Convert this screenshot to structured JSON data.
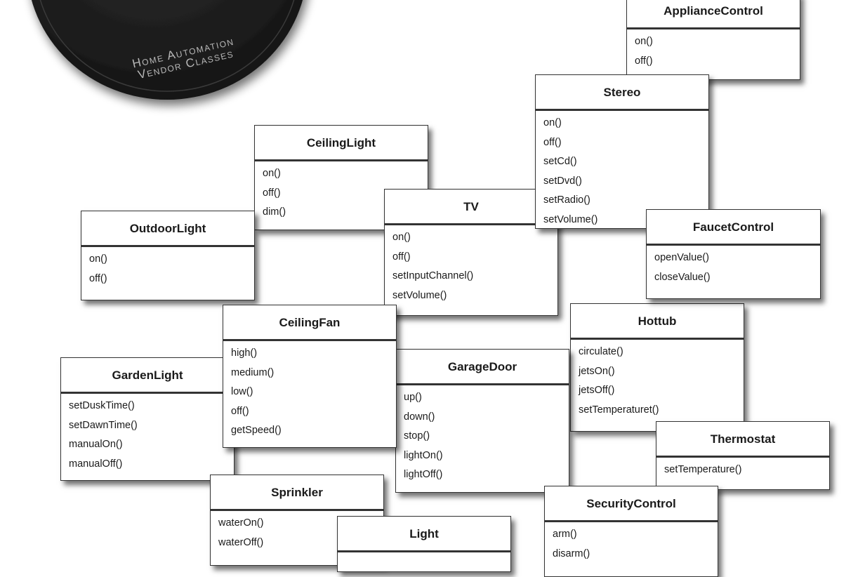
{
  "disc": {
    "line1": "Home Automation",
    "line2": "Vendor Classes"
  },
  "classes": [
    {
      "name": "ApplianceControl",
      "methods": [
        "on()",
        "off()"
      ]
    },
    {
      "name": "Stereo",
      "methods": [
        "on()",
        "off()",
        "setCd()",
        "setDvd()",
        "setRadio()",
        "setVolume()"
      ]
    },
    {
      "name": "CeilingLight",
      "methods": [
        "on()",
        "off()",
        "dim()"
      ]
    },
    {
      "name": "OutdoorLight",
      "methods": [
        "on()",
        "off()"
      ]
    },
    {
      "name": "TV",
      "methods": [
        "on()",
        "off()",
        "setInputChannel()",
        "setVolume()"
      ]
    },
    {
      "name": "FaucetControl",
      "methods": [
        "openValue()",
        "closeValue()"
      ]
    },
    {
      "name": "CeilingFan",
      "methods": [
        "high()",
        "medium()",
        "low()",
        "off()",
        "getSpeed()"
      ]
    },
    {
      "name": "Hottub",
      "methods": [
        "circulate()",
        "jetsOn()",
        "jetsOff()",
        "setTemperaturet()"
      ]
    },
    {
      "name": "GardenLight",
      "methods": [
        "setDuskTime()",
        "setDawnTime()",
        "manualOn()",
        "manualOff()"
      ]
    },
    {
      "name": "GarageDoor",
      "methods": [
        "up()",
        "down()",
        "stop()",
        "lightOn()",
        "lightOff()"
      ]
    },
    {
      "name": "Thermostat",
      "methods": [
        "setTemperature()"
      ]
    },
    {
      "name": "Sprinkler",
      "methods": [
        "waterOn()",
        "waterOff()"
      ]
    },
    {
      "name": "SecurityControl",
      "methods": [
        "arm()",
        "disarm()"
      ]
    },
    {
      "name": "Light",
      "methods": []
    }
  ]
}
